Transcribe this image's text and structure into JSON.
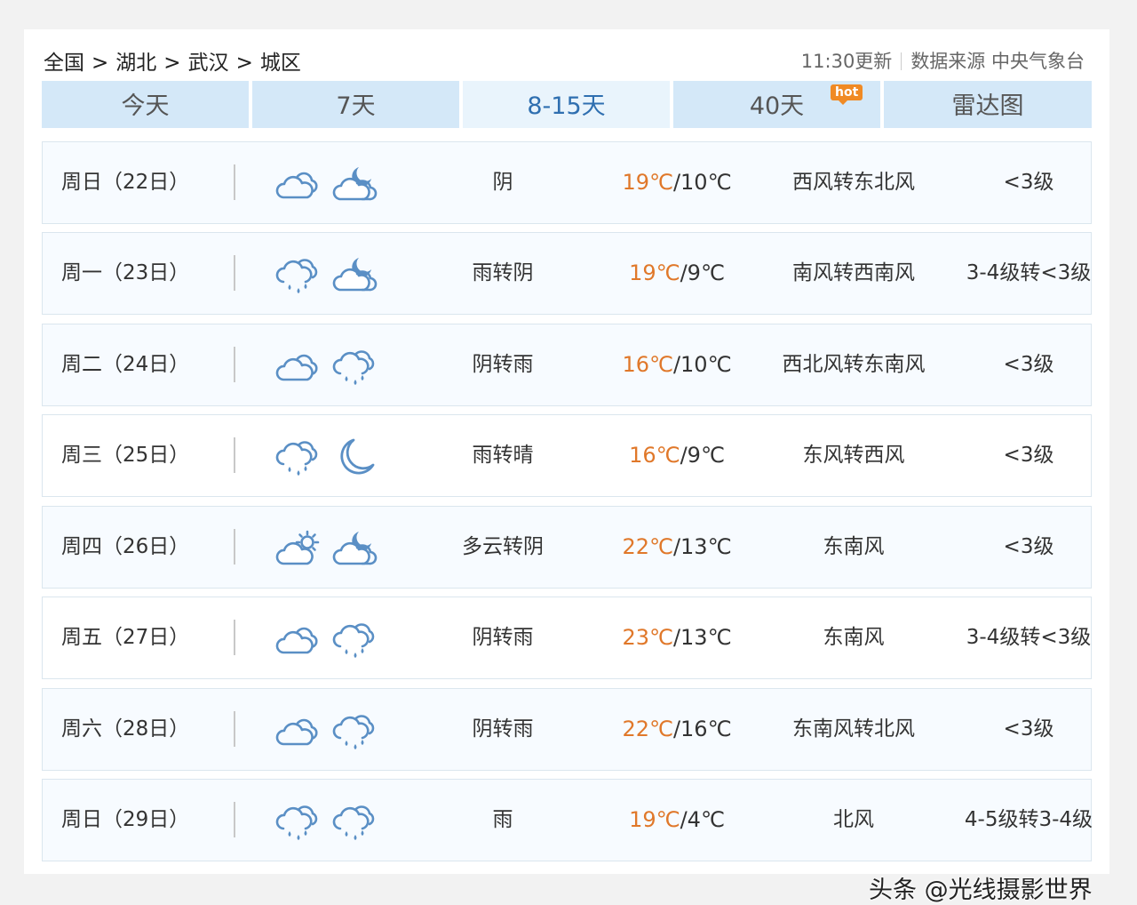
{
  "breadcrumb": {
    "items": [
      "全国",
      "湖北",
      "武汉",
      "城区"
    ],
    "separator": ">"
  },
  "source": {
    "updated": "11:30更新",
    "label": "数据来源 中央气象台"
  },
  "tabs": [
    {
      "label": "今天"
    },
    {
      "label": "7天"
    },
    {
      "label": "8-15天",
      "active": true
    },
    {
      "label": "40天",
      "badge": "hot"
    },
    {
      "label": "雷达图"
    }
  ],
  "colors": {
    "tab_bg": "#d4e8f8",
    "tab_active_bg": "#e9f4fc",
    "tab_active_text": "#2f6fb0",
    "high_temp": "#e0782a",
    "hot_badge": "#f08a24",
    "icon_stroke": "#5a8fc5"
  },
  "forecast": [
    {
      "date": "周日（22日）",
      "icon_day": "cloudy-icon",
      "icon_night": "cloudy-night-icon",
      "weather": "阴",
      "high": "19℃",
      "low": "/10℃",
      "wind": "西风转东北风",
      "level": "<3级"
    },
    {
      "date": "周一（23日）",
      "icon_day": "rain-icon",
      "icon_night": "cloudy-night-icon",
      "weather": "雨转阴",
      "high": "19℃",
      "low": "/9℃",
      "wind": "南风转西南风",
      "level": "3-4级转<3级"
    },
    {
      "date": "周二（24日）",
      "icon_day": "cloudy-icon",
      "icon_night": "rain-icon",
      "weather": "阴转雨",
      "high": "16℃",
      "low": "/10℃",
      "wind": "西北风转东南风",
      "level": "<3级"
    },
    {
      "date": "周三（25日）",
      "icon_day": "rain-icon",
      "icon_night": "moon-icon",
      "weather": "雨转晴",
      "high": "16℃",
      "low": "/9℃",
      "wind": "东风转西风",
      "level": "<3级"
    },
    {
      "date": "周四（26日）",
      "icon_day": "partly-cloudy-icon",
      "icon_night": "cloudy-night-icon",
      "weather": "多云转阴",
      "high": "22℃",
      "low": "/13℃",
      "wind": "东南风",
      "level": "<3级"
    },
    {
      "date": "周五（27日）",
      "icon_day": "cloudy-icon",
      "icon_night": "rain-icon",
      "weather": "阴转雨",
      "high": "23℃",
      "low": "/13℃",
      "wind": "东南风",
      "level": "3-4级转<3级"
    },
    {
      "date": "周六（28日）",
      "icon_day": "cloudy-icon",
      "icon_night": "rain-icon",
      "weather": "阴转雨",
      "high": "22℃",
      "low": "/16℃",
      "wind": "东南风转北风",
      "level": "<3级"
    },
    {
      "date": "周日（29日）",
      "icon_day": "rain-icon",
      "icon_night": "rain-icon",
      "weather": "雨",
      "high": "19℃",
      "low": "/4℃",
      "wind": "北风",
      "level": "4-5级转3-4级"
    }
  ],
  "watermark": "头条 @光线摄影世界"
}
